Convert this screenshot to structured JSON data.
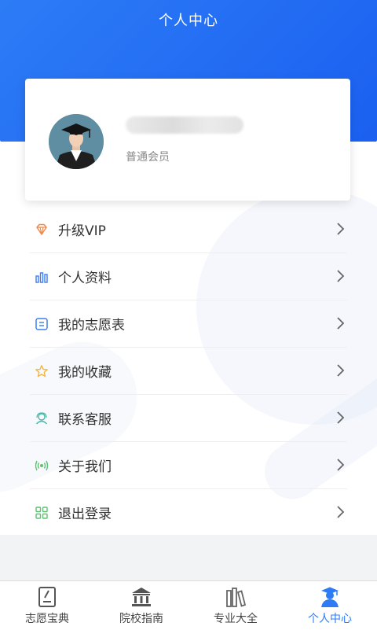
{
  "header": {
    "title": "个人中心"
  },
  "profile": {
    "member_level": "普通会员"
  },
  "menu": {
    "items": [
      {
        "label": "升级VIP",
        "icon": "diamond-icon"
      },
      {
        "label": "个人资料",
        "icon": "bar-chart-icon"
      },
      {
        "label": "我的志愿表",
        "icon": "form-icon"
      },
      {
        "label": "我的收藏",
        "icon": "star-icon"
      },
      {
        "label": "联系客服",
        "icon": "headset-icon"
      },
      {
        "label": "关于我们",
        "icon": "broadcast-icon"
      },
      {
        "label": "退出登录",
        "icon": "grid-icon"
      }
    ]
  },
  "tabbar": {
    "items": [
      {
        "label": "志愿宝典",
        "icon": "book-edit-icon"
      },
      {
        "label": "院校指南",
        "icon": "building-icon"
      },
      {
        "label": "专业大全",
        "icon": "books-icon"
      },
      {
        "label": "个人中心",
        "icon": "graduate-icon",
        "active": true
      }
    ]
  },
  "colors": {
    "primary": "#2d7cf6",
    "vip_icon": "#f08a4b",
    "profile_icon": "#3c7ef0",
    "star_icon": "#f5b640",
    "service_icon": "#4bb7a8",
    "about_icon": "#5fc270",
    "logout_icon": "#5fc270"
  }
}
